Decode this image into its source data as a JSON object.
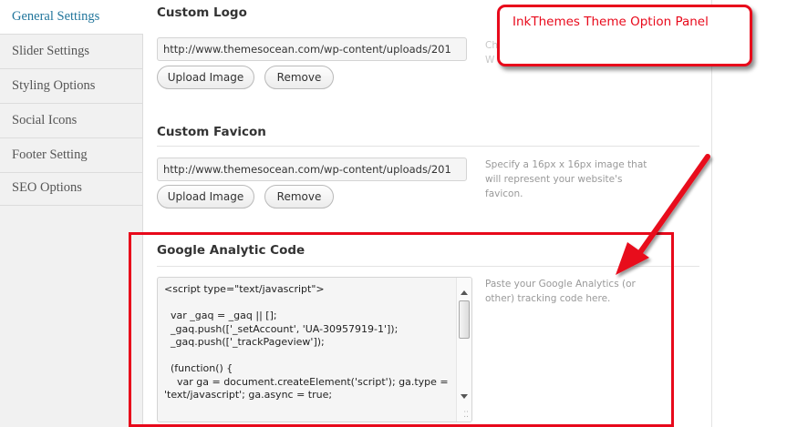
{
  "sidebar": {
    "items": [
      {
        "label": "General Settings",
        "active": true
      },
      {
        "label": "Slider Settings",
        "active": false
      },
      {
        "label": "Styling Options",
        "active": false
      },
      {
        "label": "Social Icons",
        "active": false
      },
      {
        "label": "Footer Setting",
        "active": false
      },
      {
        "label": "SEO Options",
        "active": false
      }
    ]
  },
  "custom_logo": {
    "title": "Custom Logo",
    "value": "http://www.themesocean.com/wp-content/uploads/201",
    "upload_label": "Upload Image",
    "remove_label": "Remove",
    "description_fragment": "Ch\nW"
  },
  "custom_favicon": {
    "title": "Custom Favicon",
    "value": "http://www.themesocean.com/wp-content/uploads/201",
    "upload_label": "Upload Image",
    "remove_label": "Remove",
    "description": "Specify a 16px x 16px image that will represent your website's favicon."
  },
  "analytics": {
    "title": "Google Analytic Code",
    "code": "<script type=\"text/javascript\">\n\n  var _gaq = _gaq || [];\n  _gaq.push(['_setAccount', 'UA-30957919-1']);\n  _gaq.push(['_trackPageview']);\n\n  (function() {\n    var ga = document.createElement('script'); ga.type = 'text/javascript'; ga.async = true;",
    "description": "Paste your Google Analytics (or other) tracking code here."
  },
  "annotation": {
    "callout_text": "InkThemes Theme Option Panel",
    "color": "#e8091b"
  },
  "colors": {
    "accent": "#21759b",
    "sidebar_bg": "#f1f1f1",
    "annotation_red": "#e8091b"
  }
}
